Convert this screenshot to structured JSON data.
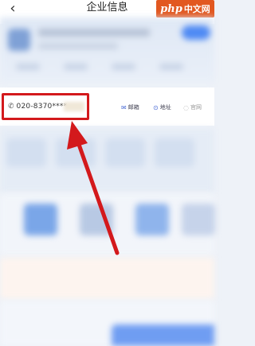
{
  "header": {
    "back_icon": "chevron-left-icon",
    "back_glyph": "‹",
    "title": "企业信息"
  },
  "watermark": {
    "brand": "php",
    "suffix": "中文网",
    "color": "#e25820"
  },
  "contact": {
    "phone_icon": "phone-icon",
    "phone_glyph": "✆",
    "phone_value": "020-8370****",
    "highlight_color": "#d3191c",
    "actions": [
      {
        "icon": "mail-icon",
        "glyph": "✉",
        "label": "邮箱"
      },
      {
        "icon": "location-icon",
        "glyph": "⊙",
        "label": "地址"
      },
      {
        "icon": "web-icon",
        "glyph": "◌",
        "label": "官网"
      }
    ]
  },
  "annotation": {
    "arrow_color": "#d3191c"
  }
}
